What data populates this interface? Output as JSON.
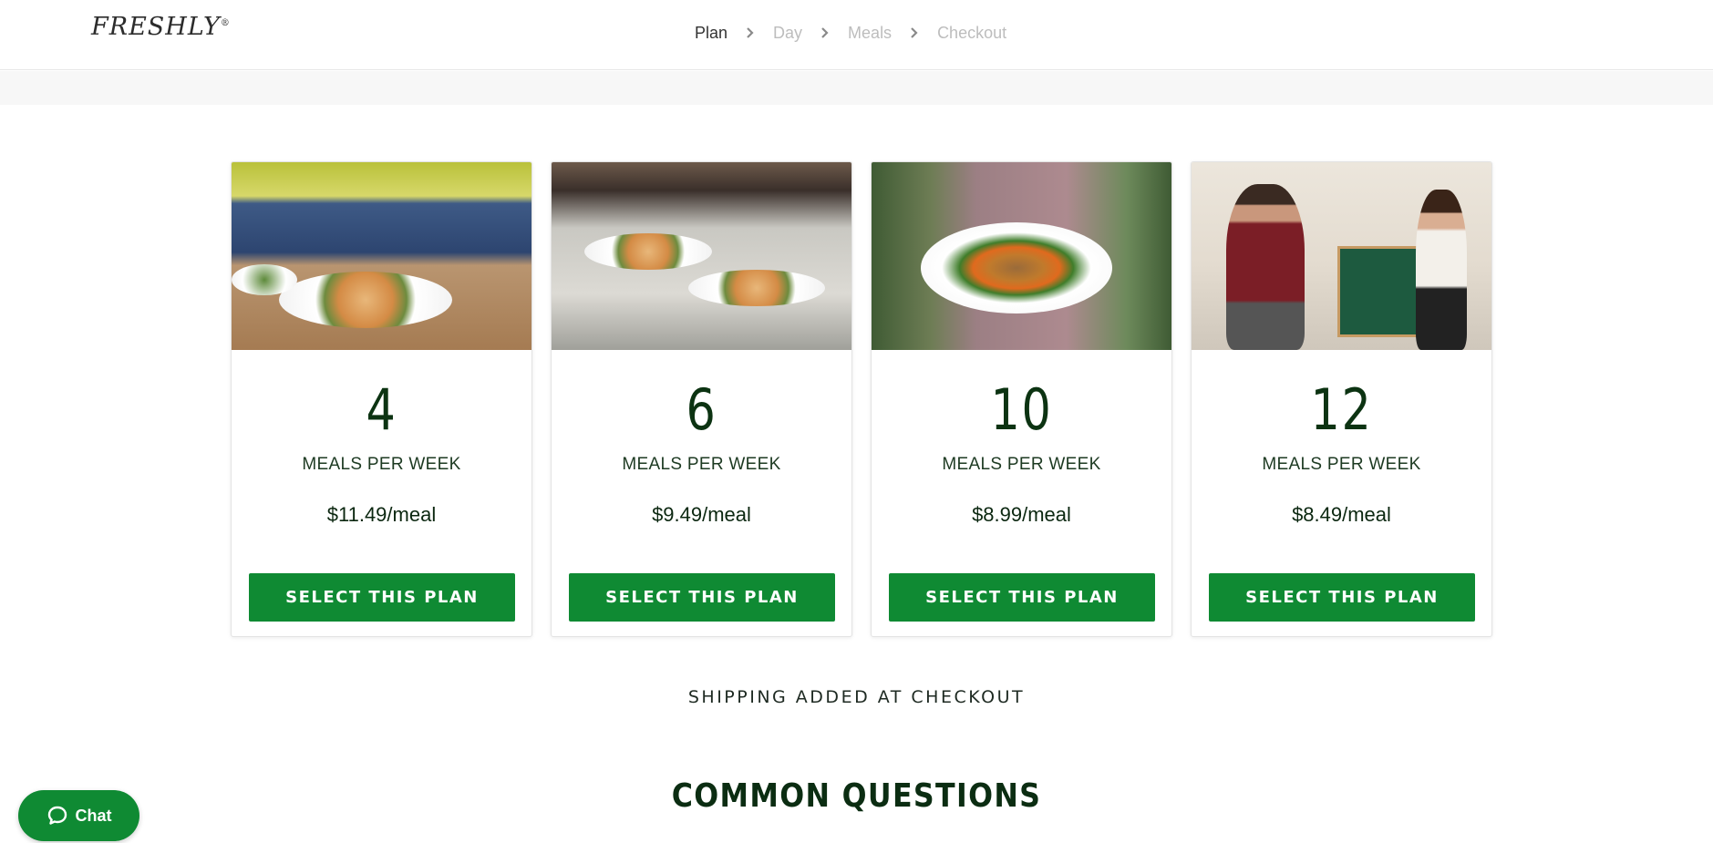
{
  "header": {
    "logo_text": "FRESHLY",
    "logo_mark": "®",
    "steps": [
      {
        "label": "Plan",
        "active": true
      },
      {
        "label": "Day",
        "active": false
      },
      {
        "label": "Meals",
        "active": false
      },
      {
        "label": "Checkout",
        "active": false
      }
    ]
  },
  "plans": [
    {
      "count": "4",
      "unit_label": "MEALS PER WEEK",
      "price": "$11.49/meal",
      "button_label": "SELECT THIS PLAN",
      "photo": "meal-prep-photo"
    },
    {
      "count": "6",
      "unit_label": "MEALS PER WEEK",
      "price": "$9.49/meal",
      "button_label": "SELECT THIS PLAN",
      "photo": "microwave-plates-photo"
    },
    {
      "count": "10",
      "unit_label": "MEALS PER WEEK",
      "price": "$8.99/meal",
      "button_label": "SELECT THIS PLAN",
      "photo": "plate-held-photo"
    },
    {
      "count": "12",
      "unit_label": "MEALS PER WEEK",
      "price": "$8.49/meal",
      "button_label": "SELECT THIS PLAN",
      "photo": "kitchen-box-photo"
    }
  ],
  "shipping_note": "SHIPPING ADDED AT CHECKOUT",
  "faq_title": "COMMON QUESTIONS",
  "chat": {
    "label": "Chat",
    "icon": "chat-bubble-icon"
  },
  "colors": {
    "brand_green": "#0f8a33",
    "dark_green_text": "#0c3312"
  }
}
